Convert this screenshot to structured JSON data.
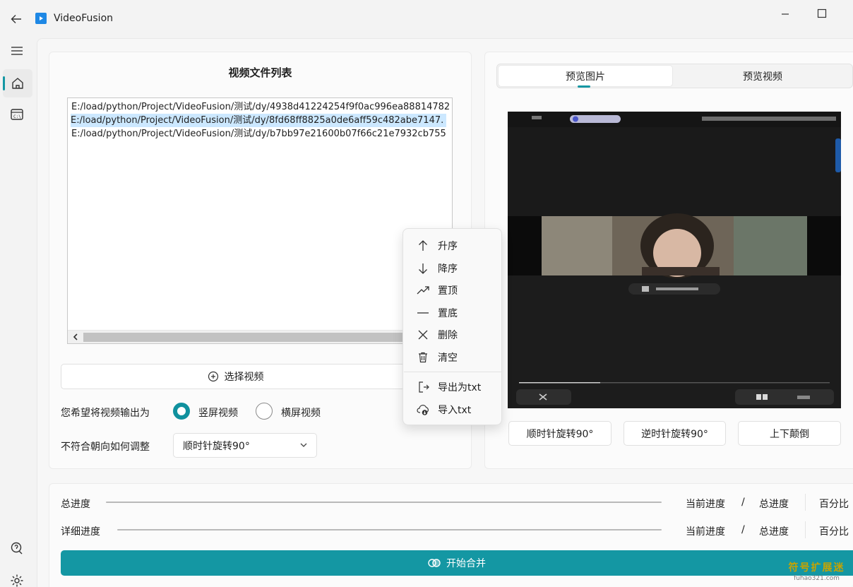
{
  "app": {
    "title": "VideoFusion"
  },
  "file_list": {
    "title": "视频文件列表",
    "items": [
      "E:/load/python/Project/VideoFusion/测试/dy/4938d41224254f9f0ac996ea88814782",
      "E:/load/python/Project/VideoFusion/测试/dy/8fd68ff8825a0de6aff59c482abe7147.",
      "E:/load/python/Project/VideoFusion/测试/dy/b7bb97e21600b07f66c21e7932cb755"
    ],
    "selected_index": 1
  },
  "select_video_label": "选择视频",
  "output": {
    "label": "您希望将视频输出为",
    "options": [
      "竖屏视频",
      "横屏视频"
    ],
    "selected": "竖屏视频"
  },
  "orientation": {
    "label": "不符合朝向如何调整",
    "value": "顺时针旋转90°"
  },
  "preview": {
    "tabs": [
      "预览图片",
      "预览视频"
    ],
    "active_tab": "预览图片",
    "buttons": [
      "顺时针旋转90°",
      "逆时针旋转90°",
      "上下颠倒"
    ]
  },
  "progress": {
    "total_label": "总进度",
    "detail_label": "详细进度",
    "current": "当前进度",
    "separator": "/",
    "total": "总进度",
    "percent": "百分比"
  },
  "start_button_label": "开始合并",
  "context_menu": {
    "items": [
      "升序",
      "降序",
      "置顶",
      "置底",
      "删除",
      "清空"
    ],
    "io_items": [
      "导出为txt",
      "导入txt"
    ],
    "icons": [
      "arrow-up-icon",
      "arrow-down-icon",
      "trend-up-icon",
      "minus-icon",
      "close-icon",
      "trash-icon",
      "export-icon",
      "import-icon"
    ]
  },
  "watermark": {
    "main": "符号扩展迷",
    "sub": "fuhao321.com"
  },
  "colors": {
    "accent": "#1497a3",
    "selection": "#cce8ff"
  }
}
